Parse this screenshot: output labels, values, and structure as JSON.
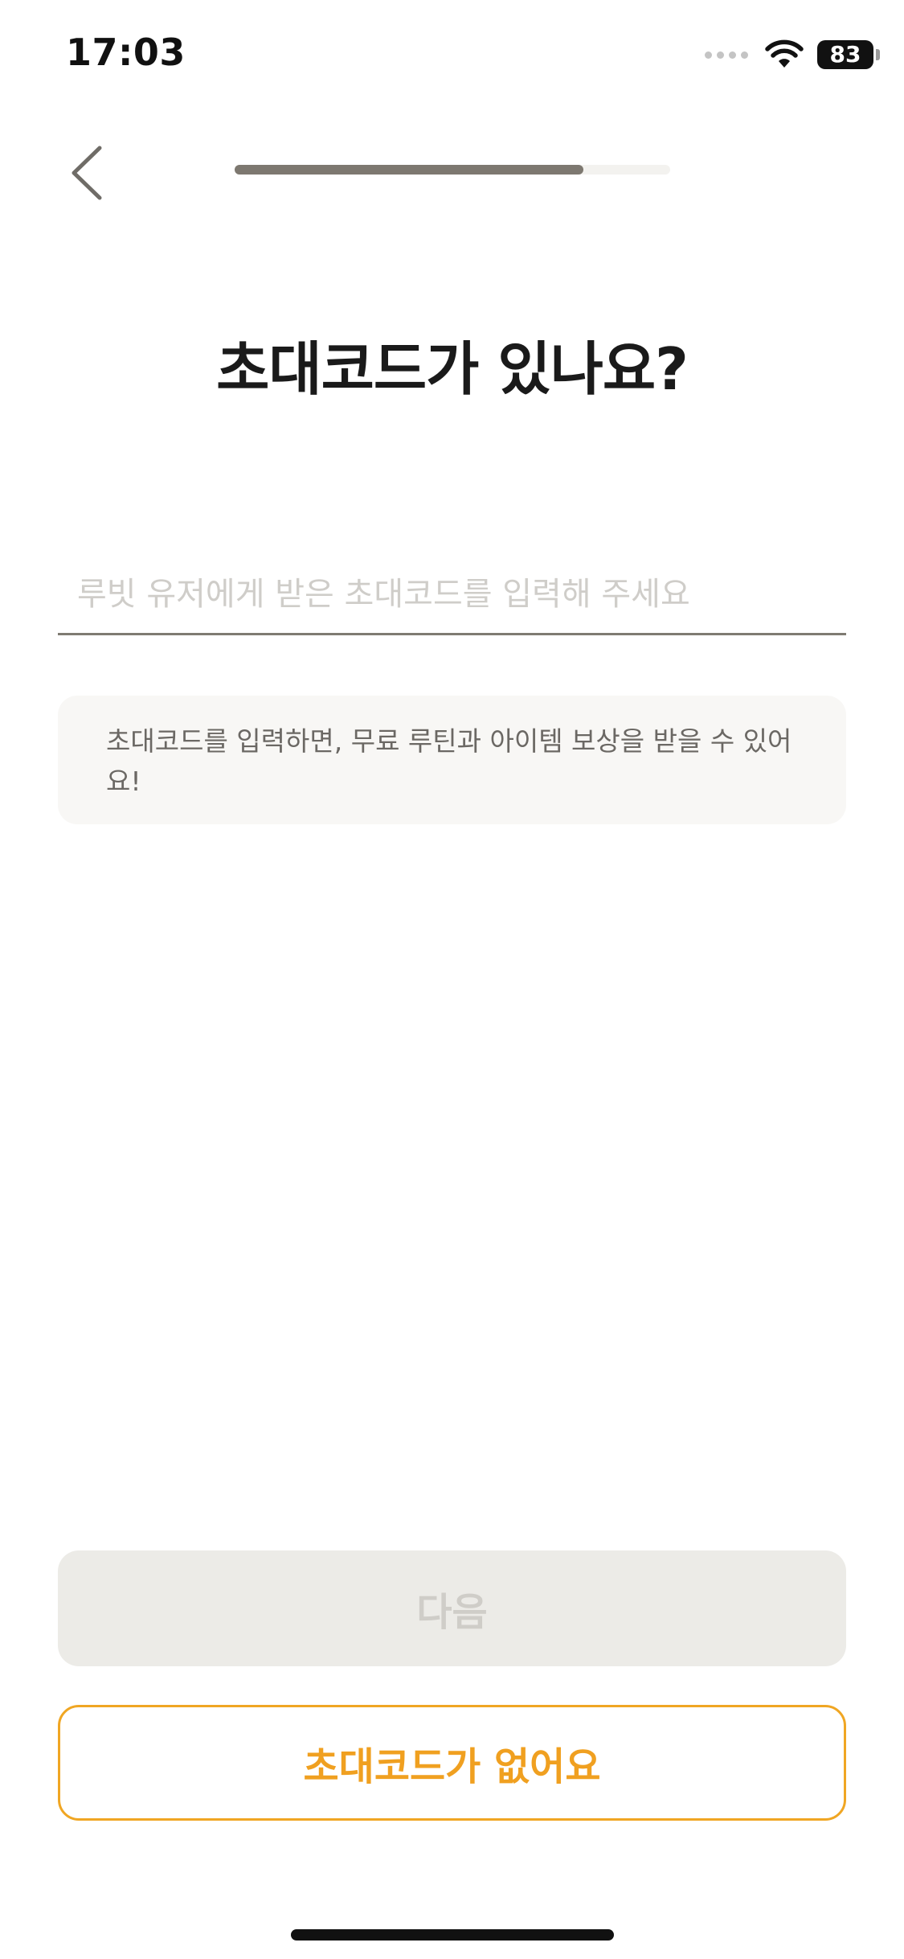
{
  "status_bar": {
    "time": "17:03",
    "battery": "83",
    "icons": [
      "signal-icon",
      "wifi-icon",
      "battery-icon"
    ]
  },
  "header": {
    "back_icon": "chevron-left-icon",
    "progress": 0.8
  },
  "main": {
    "title": "초대코드가 있나요?",
    "code_input": {
      "value": "",
      "placeholder": "루빗 유저에게 받은 초대코드를 입력해 주세요"
    },
    "info_text": "초대코드를 입력하면, 무료 루틴과 아이템 보상을 받을 수 있어요!"
  },
  "actions": {
    "next_label": "다음",
    "no_code_label": "초대코드가 없어요"
  },
  "colors": {
    "accent": "#f0a623",
    "progress_fill": "#7d7870",
    "disabled_button": "#ecebe7"
  }
}
